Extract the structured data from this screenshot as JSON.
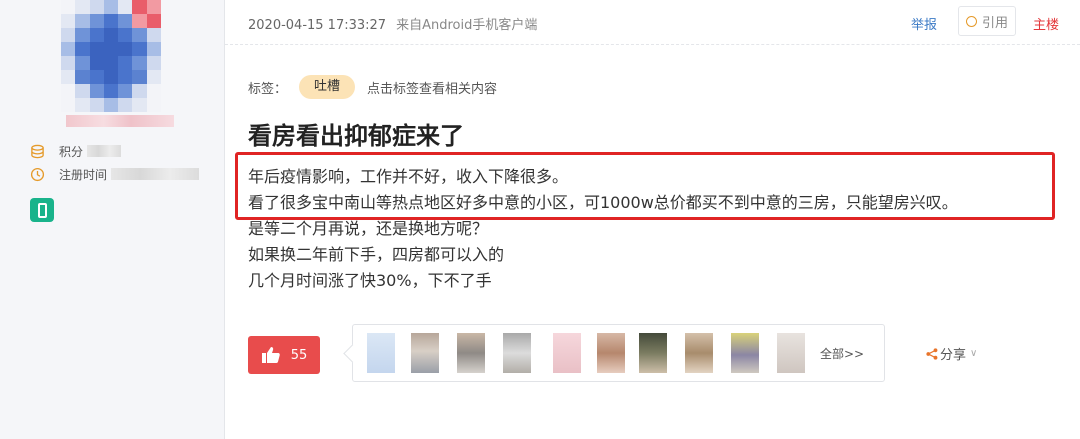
{
  "user": {
    "points_label": "积分",
    "register_label": "注册时间"
  },
  "post": {
    "timestamp": "2020-04-15 17:33:27",
    "source": "来自Android手机客户端",
    "actions": {
      "report": "举报",
      "quote": "引用",
      "op": "主楼"
    },
    "tags_label": "标签：",
    "tag": "吐槽",
    "tag_hint": "点击标签查看相关内容",
    "title": "看房看出抑郁症来了",
    "body": [
      "年后疫情影响，工作并不好，收入下降很多。",
      "看了很多宝中南山等热点地区好多中意的小区，可1000w总价都买不到中意的三房，只能望房兴叹。",
      "是等二个月再说，还是换地方呢？",
      "如果换二年前下手，四房都可以入的",
      "几个月时间涨了快30%，下不了手"
    ],
    "likes": "55",
    "view_all": "全部>>",
    "share": "分享"
  },
  "colors": {
    "accent_red": "#e84c4c",
    "highlight_border": "#e02424",
    "tag_bg": "#fce3b6",
    "link_blue": "#3c7bc6",
    "mobile_badge": "#19b38b"
  }
}
